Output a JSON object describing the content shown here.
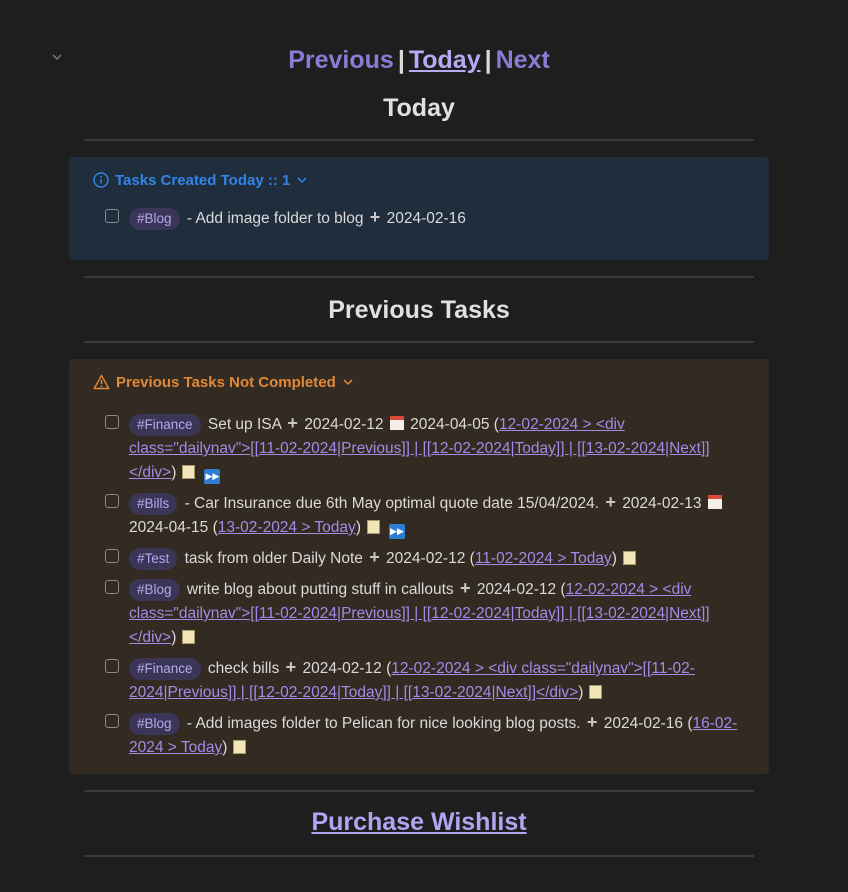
{
  "nav": {
    "previous": "Previous",
    "today": "Today",
    "next": "Next",
    "separator": "|"
  },
  "headings": {
    "today": "Today",
    "previous_tasks": "Previous Tasks"
  },
  "created_today": {
    "title": "Tasks Created Today :: 1",
    "icon": "info-icon",
    "color": "#2f86e6",
    "tasks": [
      {
        "tag": "#Blog",
        "text": "- Add image folder to blog",
        "date": "2024-02-16"
      }
    ]
  },
  "not_completed": {
    "title": "Previous Tasks Not Completed",
    "icon": "warning-icon",
    "color": "#e0893a",
    "tasks": [
      {
        "tag": "#Finance",
        "text": "Set up ISA",
        "date": "2024-02-12",
        "due": "2024-04-05",
        "link": "12-02-2024 > <div class=\"dailynav\">[[11-02-2024|Previous]] | [[12-02-2024|Today]] | [[13-02-2024|Next]]</div>"
      },
      {
        "tag": "#Bills",
        "text": "- Car Insurance due 6th May optimal quote date 15/04/2024.",
        "date": "2024-02-13",
        "due": "2024-04-15",
        "link": "13-02-2024 > Today"
      },
      {
        "tag": "#Test",
        "text": "task from older Daily Note",
        "date": "2024-02-12",
        "link": "11-02-2024 > Today"
      },
      {
        "tag": "#Blog",
        "text": "write blog about putting stuff in callouts",
        "date": "2024-02-12",
        "link": "12-02-2024 > <div class=\"dailynav\">[[11-02-2024|Previous]] | [[12-02-2024|Today]] | [[13-02-2024|Next]]</div>"
      },
      {
        "tag": "#Finance",
        "text": "check bills",
        "date": "2024-02-12",
        "link": "12-02-2024 > <div class=\"dailynav\">[[11-02-2024|Previous]] | [[12-02-2024|Today]] | [[13-02-2024|Next]]</div>"
      },
      {
        "tag": "#Blog",
        "text": "- Add images folder to Pelican for nice looking blog posts.",
        "date": "2024-02-16",
        "link": "16-02-2024 > Today"
      }
    ]
  },
  "wishlist_link": "Purchase Wishlist"
}
